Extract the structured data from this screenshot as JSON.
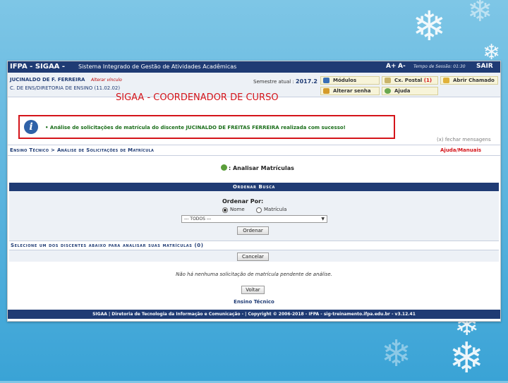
{
  "app": {
    "title": "IFPA - SIGAA -",
    "subtitle": "Sistema Integrado de Gestão de Atividades Acadêmicas"
  },
  "topbar": {
    "font_up": "A+",
    "font_down": "A-",
    "session_label": "Tempo de Sessão: 01:30",
    "logout": "SAIR"
  },
  "user": {
    "name": "JUCINALDO DE F. FERREIRA",
    "change_link": "Alterar vínculo",
    "dept": "C. DE ENS/DIRETORIA DE ENSINO (11.02.02)"
  },
  "semester": {
    "label": "Semestre atual :",
    "value": "2017.2"
  },
  "menu": {
    "modules": "Módulos",
    "postal": "Cx. Postal",
    "postal_count": "(1)",
    "open_ticket": "Abrir Chamado",
    "change_password": "Alterar senha",
    "help": "Ajuda"
  },
  "role_banner": "SIGAA - COORDENADOR DE CURSO",
  "message": {
    "bullet": "•",
    "text": "Análise de solicitações de matrícula do discente JUCINALDO DE FREITAS FERREIRA realizada com sucesso!",
    "close": "(x) fechar mensagens"
  },
  "breadcrumb": "Ensino Técnico > Análise de Solicitações de Matrícula",
  "help_link": "Ajuda/Manuais",
  "page_title": ": Analisar Matrículas",
  "search": {
    "header": "Ordenar Busca",
    "order_label": "Ordenar Por:",
    "option_name": "Nome",
    "option_matricula": "Matrícula",
    "select_value": "--- TODOS ---",
    "order_button": "Ordenar",
    "select_students_header": "Selecione um dos discentes abaixo para analisar suas matrículas (0)",
    "cancel_button": "Cancelar"
  },
  "empty_message": "Não há nenhuma solicitação de matrícula pendente de análise.",
  "back_button": "Voltar",
  "section_link": "Ensino Técnico",
  "footer": "SIGAA | Diretoria de Tecnologia da Informação e Comunicação - | Copyright © 2006-2018 - IFPA - sig-treinamento.ifpa.edu.br - v3.12.41",
  "colors": {
    "accent": "#1f3b74",
    "alert": "#d4141a",
    "success": "#1a6e1a",
    "background": "#3aa3d6"
  }
}
